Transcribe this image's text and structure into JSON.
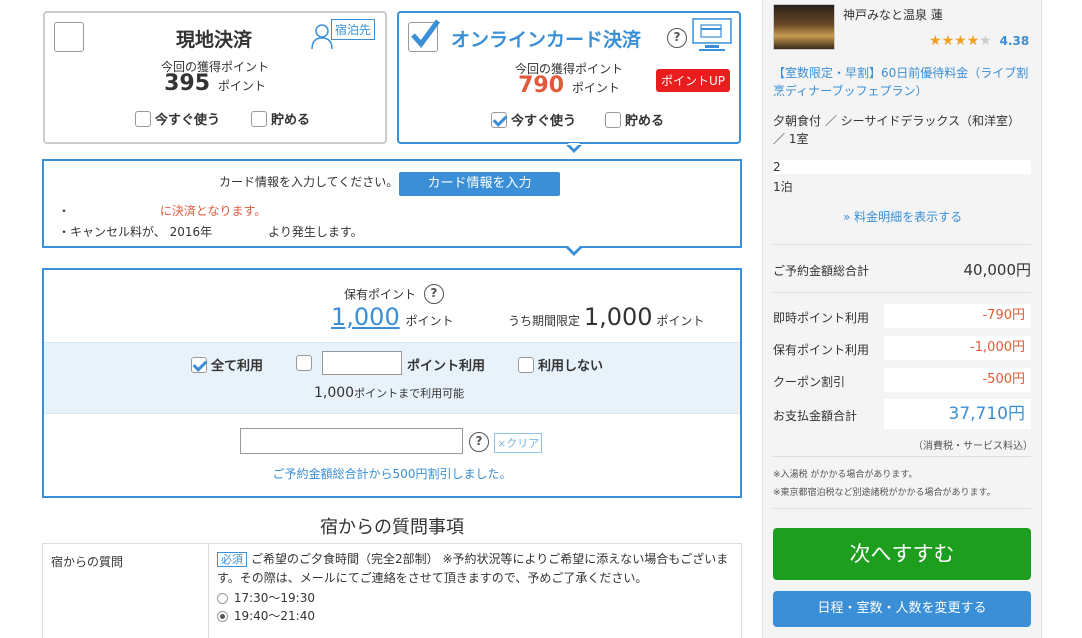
{
  "payment": {
    "local": {
      "title": "現地決済",
      "badge": "宿泊先",
      "points_label": "今回の獲得ポイント",
      "points": "395",
      "points_unit": "ポイント",
      "use_now": "今すぐ使う",
      "save": "貯める"
    },
    "online": {
      "title": "オンラインカード決済",
      "points_label": "今回の獲得ポイント",
      "points": "790",
      "points_unit": "ポイント",
      "point_up": "ポイントUP",
      "use_now": "今すぐ使う",
      "save": "貯める",
      "help": "?"
    }
  },
  "card_info": {
    "prompt": "カード情報を入力してください。",
    "button": "カード情報を入力",
    "note1": "・",
    "note1_red": "に決済となります。",
    "note2": "・キャンセル料が、 2016年",
    "note2_tail": "より発生します。"
  },
  "points_panel": {
    "held_label": "保有ポイント",
    "held_value": "1,000",
    "held_unit": "ポイント",
    "limited_label": "うち期間限定",
    "limited_value": "1,000",
    "limited_unit": "ポイント",
    "use_all": "全て利用",
    "use_points": "ポイント利用",
    "no_use": "利用しない",
    "available_prefix": "1,000",
    "available_suffix": "ポイントまで利用可能",
    "coupon_placeholder": "",
    "clear": "×クリア",
    "coupon_msg": "ご予約金額総合計から500円割引しました。"
  },
  "questions": {
    "heading": "宿からの質問事項",
    "row_label": "宿からの質問",
    "required": "必須",
    "question": "ご希望のご夕食時間（完全2部制） ※予約状況等によりご希望に添えない場合もございます。その際は、メールにてご連絡をさせて頂きますので、予めご了承ください。",
    "options": [
      "17:30〜19:30",
      "19:40〜21:40"
    ]
  },
  "sidebar": {
    "hotel_name": "神戸みなと温泉 蓮",
    "rating": "4.38",
    "plan": "【室数限定・早割】60日前優待料金（ライブ割烹ディナーブッフェプラン）",
    "room": "夕朝食付 ／ シーサイドデラックス（和洋室） ／ 1室",
    "date": "2",
    "nights": "1泊",
    "show_details": "» 料金明細を表示する",
    "total_label": "ご予約金額総合計",
    "total_value": "40,000円",
    "rows": [
      {
        "label": "即時ポイント利用",
        "value": "-790円"
      },
      {
        "label": "保有ポイント利用",
        "value": "-1,000円"
      },
      {
        "label": "クーポン割引",
        "value": "-500円"
      }
    ],
    "pay_label": "お支払金額合計",
    "pay_value": "37,710円",
    "tax_note": "（消費税・サービス料込）",
    "note1": "※入湯税 がかかる場合があります。",
    "note2": "※東京都宿泊税など別途諸税がかかる場合があります。",
    "next_button": "次へすすむ",
    "change_button": "日程・室数・人数を変更する"
  },
  "colors": {
    "accent": "#3a8fd6",
    "green": "#1e9e1e",
    "red": "#e05a3a"
  }
}
